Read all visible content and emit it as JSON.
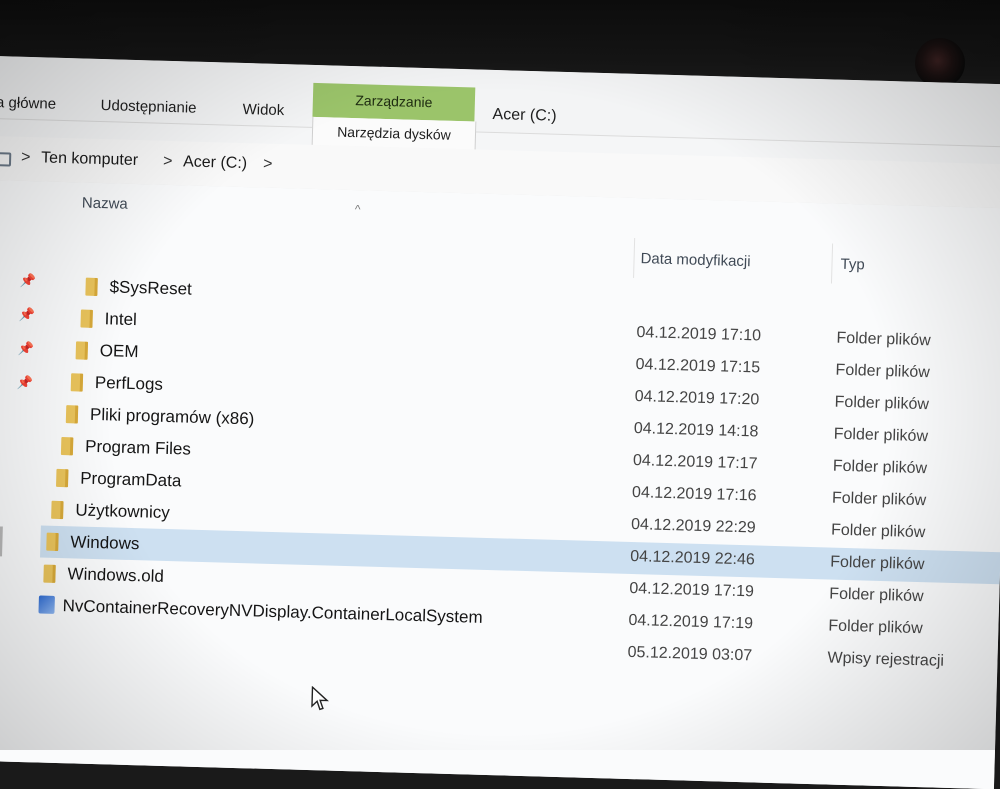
{
  "ribbon": {
    "tabs": [
      {
        "label": "ia główne"
      },
      {
        "label": "Udostępnianie"
      },
      {
        "label": "Widok"
      }
    ],
    "context_group_label": "Zarządzanie",
    "context_tab_label": "Narzędzia dysków",
    "drive_title": "Acer (C:)",
    "context_color": "#9bc46a"
  },
  "breadcrumb": {
    "items": [
      "Ten komputer",
      "Acer (C:)"
    ],
    "separator": ">"
  },
  "columns": {
    "name": "Nazwa",
    "date": "Data modyfikacji",
    "type": "Typ"
  },
  "files": [
    {
      "name": "$SysReset",
      "date": "",
      "type": "",
      "icon": "folder-icon"
    },
    {
      "name": "Intel",
      "date": "04.12.2019 17:10",
      "type": "Folder plików",
      "icon": "folder-icon"
    },
    {
      "name": "OEM",
      "date": "04.12.2019 17:15",
      "type": "Folder plików",
      "icon": "folder-icon"
    },
    {
      "name": "PerfLogs",
      "date": "04.12.2019 17:20",
      "type": "Folder plików",
      "icon": "folder-icon"
    },
    {
      "name": "Pliki programów (x86)",
      "date": "04.12.2019 14:18",
      "type": "Folder plików",
      "icon": "folder-icon"
    },
    {
      "name": "Program Files",
      "date": "04.12.2019 17:17",
      "type": "Folder plików",
      "icon": "folder-icon"
    },
    {
      "name": "ProgramData",
      "date": "04.12.2019 17:16",
      "type": "Folder plików",
      "icon": "folder-icon"
    },
    {
      "name": "Użytkownicy",
      "date": "04.12.2019 22:29",
      "type": "Folder plików",
      "icon": "folder-icon"
    },
    {
      "name": "Windows",
      "date": "04.12.2019 22:46",
      "type": "Folder plików",
      "icon": "folder-icon",
      "selected": true
    },
    {
      "name": "Windows.old",
      "date": "04.12.2019 17:19",
      "type": "Folder plików",
      "icon": "folder-icon"
    },
    {
      "name": "NvContainerRecoveryNVDisplay.ContainerLocalSystem",
      "date": "04.12.2019 17:19",
      "type": "Folder plików",
      "icon": "registry-file-icon"
    },
    {
      "name": "",
      "date": "05.12.2019 03:07",
      "type": "Wpisy rejestracji",
      "icon": ""
    }
  ],
  "colors": {
    "selection": "#cde0f1",
    "folder": "#e9c35b"
  }
}
